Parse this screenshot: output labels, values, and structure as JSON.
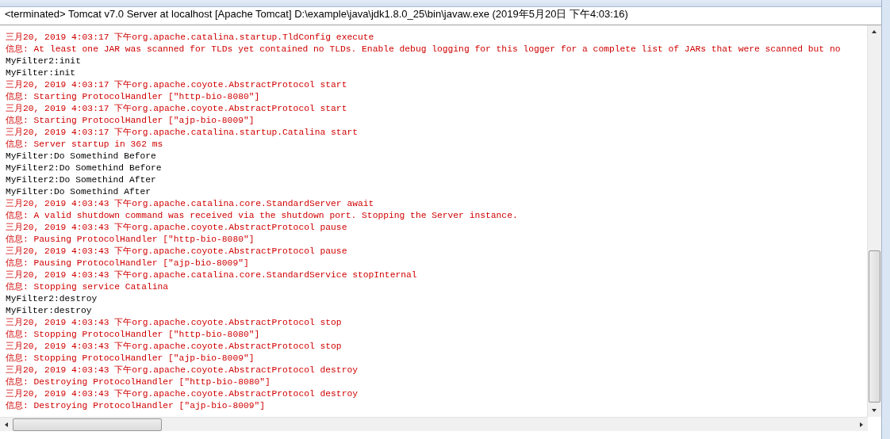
{
  "console": {
    "title": "<terminated> Tomcat v7.0 Server at localhost [Apache Tomcat] D:\\example\\java\\jdk1.8.0_25\\bin\\javaw.exe (2019年5月20日 下午4:03:16)",
    "lines": [
      {
        "kind": "err",
        "text": "三月20, 2019 4:03:17 下午org.apache.catalina.startup.TldConfig execute"
      },
      {
        "kind": "err",
        "text": "信息: At least one JAR was scanned for TLDs yet contained no TLDs. Enable debug logging for this logger for a complete list of JARs that were scanned but no"
      },
      {
        "kind": "out",
        "text": "MyFilter2:init"
      },
      {
        "kind": "out",
        "text": "MyFilter:init"
      },
      {
        "kind": "err",
        "text": "三月20, 2019 4:03:17 下午org.apache.coyote.AbstractProtocol start"
      },
      {
        "kind": "err",
        "text": "信息: Starting ProtocolHandler [\"http-bio-8080\"]"
      },
      {
        "kind": "err",
        "text": "三月20, 2019 4:03:17 下午org.apache.coyote.AbstractProtocol start"
      },
      {
        "kind": "err",
        "text": "信息: Starting ProtocolHandler [\"ajp-bio-8009\"]"
      },
      {
        "kind": "err",
        "text": "三月20, 2019 4:03:17 下午org.apache.catalina.startup.Catalina start"
      },
      {
        "kind": "err",
        "text": "信息: Server startup in 362 ms"
      },
      {
        "kind": "out",
        "text": "MyFilter:Do Somethind Before"
      },
      {
        "kind": "out",
        "text": "MyFilter2:Do Somethind Before"
      },
      {
        "kind": "out",
        "text": "MyFilter2:Do Somethind After"
      },
      {
        "kind": "out",
        "text": "MyFilter:Do Somethind After"
      },
      {
        "kind": "err",
        "text": "三月20, 2019 4:03:43 下午org.apache.catalina.core.StandardServer await"
      },
      {
        "kind": "err",
        "text": "信息: A valid shutdown command was received via the shutdown port. Stopping the Server instance."
      },
      {
        "kind": "err",
        "text": "三月20, 2019 4:03:43 下午org.apache.coyote.AbstractProtocol pause"
      },
      {
        "kind": "err",
        "text": "信息: Pausing ProtocolHandler [\"http-bio-8080\"]"
      },
      {
        "kind": "err",
        "text": "三月20, 2019 4:03:43 下午org.apache.coyote.AbstractProtocol pause"
      },
      {
        "kind": "err",
        "text": "信息: Pausing ProtocolHandler [\"ajp-bio-8009\"]"
      },
      {
        "kind": "err",
        "text": "三月20, 2019 4:03:43 下午org.apache.catalina.core.StandardService stopInternal"
      },
      {
        "kind": "err",
        "text": "信息: Stopping service Catalina"
      },
      {
        "kind": "out",
        "text": "MyFilter2:destroy"
      },
      {
        "kind": "out",
        "text": "MyFilter:destroy"
      },
      {
        "kind": "err",
        "text": "三月20, 2019 4:03:43 下午org.apache.coyote.AbstractProtocol stop"
      },
      {
        "kind": "err",
        "text": "信息: Stopping ProtocolHandler [\"http-bio-8080\"]"
      },
      {
        "kind": "err",
        "text": "三月20, 2019 4:03:43 下午org.apache.coyote.AbstractProtocol stop"
      },
      {
        "kind": "err",
        "text": "信息: Stopping ProtocolHandler [\"ajp-bio-8009\"]"
      },
      {
        "kind": "err",
        "text": "三月20, 2019 4:03:43 下午org.apache.coyote.AbstractProtocol destroy"
      },
      {
        "kind": "err",
        "text": "信息: Destroying ProtocolHandler [\"http-bio-8080\"]"
      },
      {
        "kind": "err",
        "text": "三月20, 2019 4:03:43 下午org.apache.coyote.AbstractProtocol destroy"
      },
      {
        "kind": "err",
        "text": "信息: Destroying ProtocolHandler [\"ajp-bio-8009\"]"
      }
    ]
  }
}
